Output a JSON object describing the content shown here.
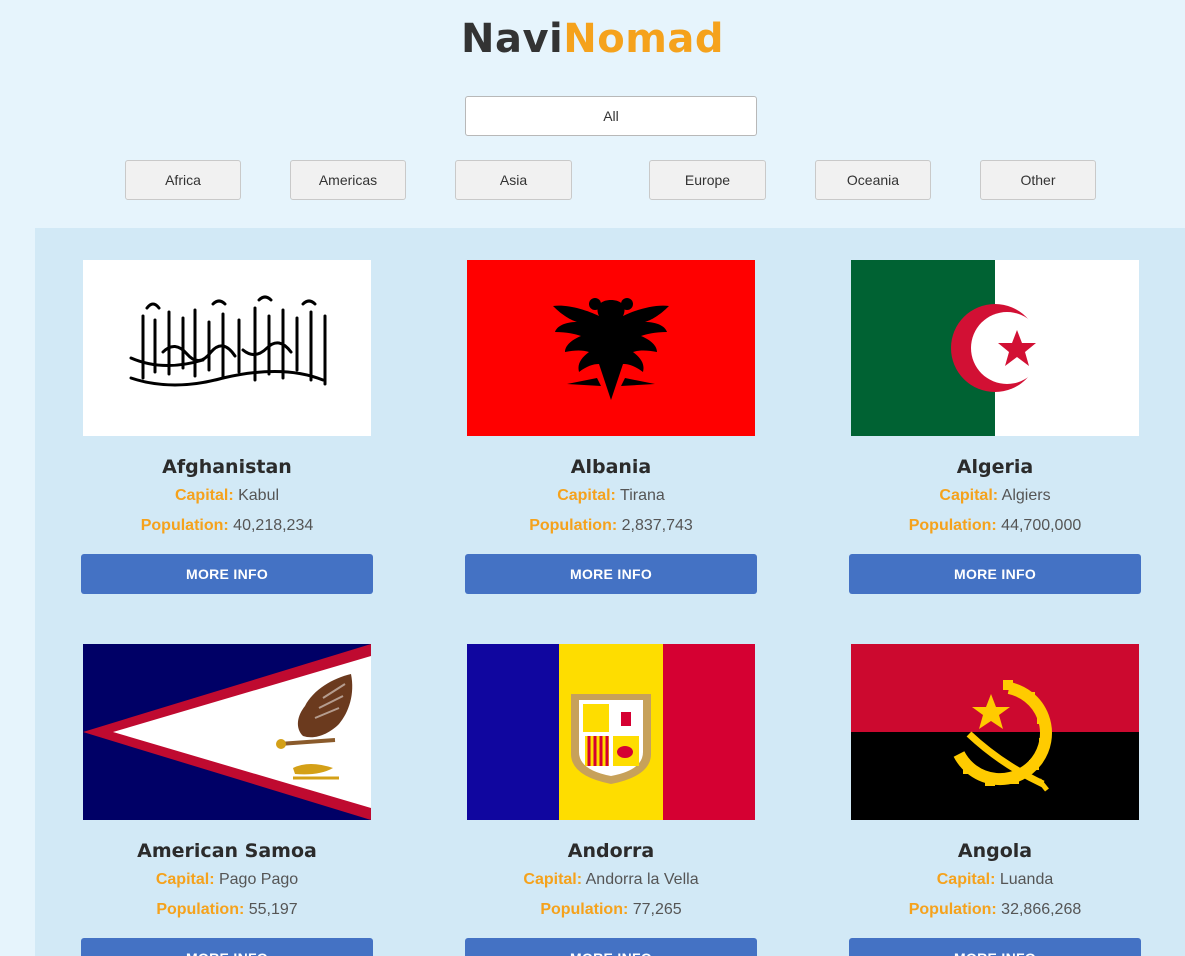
{
  "brand": {
    "part1": "Navi",
    "part2": "Nomad",
    "accent": "#f5a21c"
  },
  "filters": {
    "all": "All",
    "regions": [
      "Africa",
      "Americas",
      "Asia",
      "Europe",
      "Oceania",
      "Other"
    ]
  },
  "countries": [
    {
      "name": "Afghanistan",
      "capital_label": "Capital:",
      "capital": "Kabul",
      "population_label": "Population:",
      "population": "40,218,234",
      "button": "MORE INFO",
      "flag": "afghanistan-flag"
    },
    {
      "name": "Albania",
      "capital_label": "Capital:",
      "capital": "Tirana",
      "population_label": "Population:",
      "population": "2,837,743",
      "button": "MORE INFO",
      "flag": "albania-flag"
    },
    {
      "name": "Algeria",
      "capital_label": "Capital:",
      "capital": "Algiers",
      "population_label": "Population:",
      "population": "44,700,000",
      "button": "MORE INFO",
      "flag": "algeria-flag"
    },
    {
      "name": "American Samoa",
      "capital_label": "Capital:",
      "capital": "Pago Pago",
      "population_label": "Population:",
      "population": "55,197",
      "button": "MORE INFO",
      "flag": "american-samoa-flag"
    },
    {
      "name": "Andorra",
      "capital_label": "Capital:",
      "capital": "Andorra la Vella",
      "population_label": "Population:",
      "population": "77,265",
      "button": "MORE INFO",
      "flag": "andorra-flag"
    },
    {
      "name": "Angola",
      "capital_label": "Capital:",
      "capital": "Luanda",
      "population_label": "Population:",
      "population": "32,866,268",
      "button": "MORE INFO",
      "flag": "angola-flag"
    }
  ],
  "colors": {
    "button": "#4472c4",
    "background": "#e6f4fc",
    "grid_background": "#d2e9f6"
  }
}
